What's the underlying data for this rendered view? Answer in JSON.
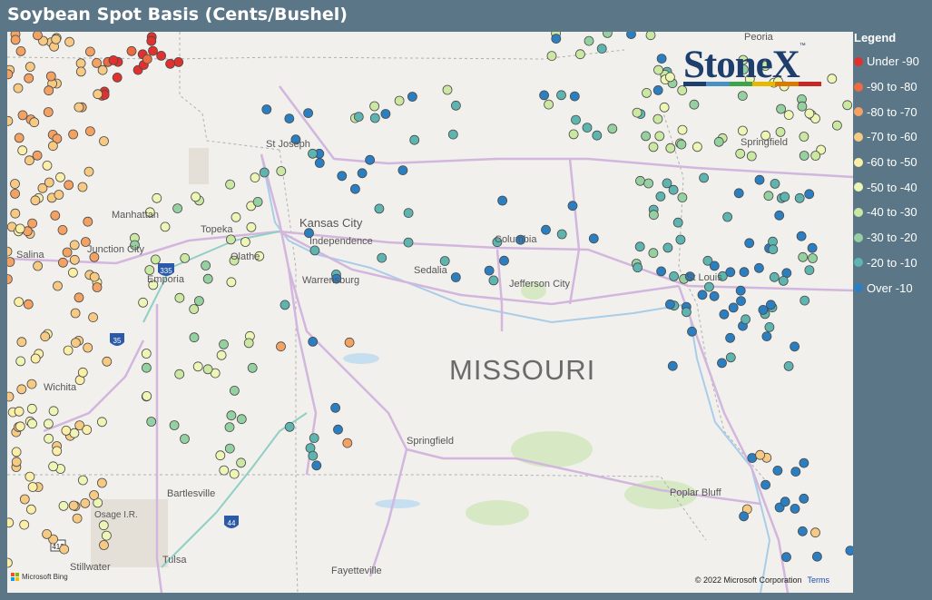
{
  "title": "Soybean Spot Basis (Cents/Bushel)",
  "logo": {
    "text": "StoneX",
    "tm": "™",
    "bar_colors": [
      "#1e3f6e",
      "#4a90c2",
      "#3fa34d",
      "#e6b800",
      "#d97a00",
      "#c62828"
    ]
  },
  "legend": {
    "title": "Legend",
    "items": [
      {
        "label": "Under -90",
        "color": "#e0312e"
      },
      {
        "label": "-90 to -80",
        "color": "#ee6a3f"
      },
      {
        "label": "-80 to -70",
        "color": "#f4a263"
      },
      {
        "label": "-70 to -60",
        "color": "#f7ca84"
      },
      {
        "label": "-60 to -50",
        "color": "#fbeea6"
      },
      {
        "label": "-50 to -40",
        "color": "#eef6b5"
      },
      {
        "label": "-40 to -30",
        "color": "#cbe8a2"
      },
      {
        "label": "-30 to -20",
        "color": "#95d1a0"
      },
      {
        "label": "-20 to -10",
        "color": "#5eb5b0"
      },
      {
        "label": "Over -10",
        "color": "#2b7fc1"
      }
    ]
  },
  "map": {
    "state_label": "MISSOURI",
    "cities": [
      {
        "name": "St Joseph"
      },
      {
        "name": "Manhattan"
      },
      {
        "name": "Topeka"
      },
      {
        "name": "Kansas City"
      },
      {
        "name": "Independence"
      },
      {
        "name": "Junction City"
      },
      {
        "name": "Salina"
      },
      {
        "name": "Olathe"
      },
      {
        "name": "Emporia"
      },
      {
        "name": "Warrensburg"
      },
      {
        "name": "Sedalia"
      },
      {
        "name": "Columbia"
      },
      {
        "name": "Jefferson City"
      },
      {
        "name": "St Louis"
      },
      {
        "name": "Springfield"
      },
      {
        "name": "Springfield"
      },
      {
        "name": "Wichita"
      },
      {
        "name": "Bartlesville"
      },
      {
        "name": "Osage I.R."
      },
      {
        "name": "Poplar Bluff"
      },
      {
        "name": "Tulsa"
      },
      {
        "name": "Stillwater"
      },
      {
        "name": "Fayetteville"
      },
      {
        "name": "Peoria"
      }
    ],
    "highway_shields": [
      "35",
      "335",
      "44",
      "412"
    ],
    "attribution": {
      "bing": "Microsoft Bing",
      "copyright": "© 2022 Microsoft Corporation",
      "terms": "Terms"
    }
  }
}
